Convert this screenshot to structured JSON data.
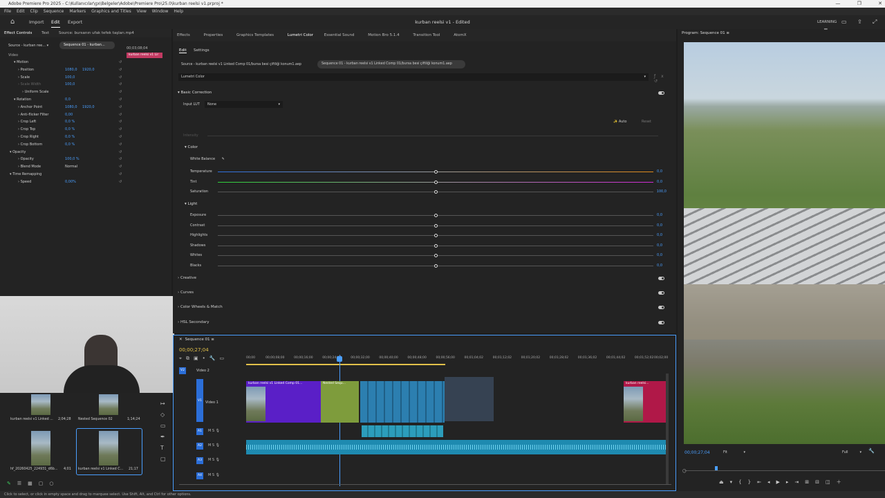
{
  "window": {
    "title": "Adobe Premiere Pro 2025 - C:\\Kullanıcılar\\gx\\Belgeler\\Adobe\\Premiere Pro\\25.0\\kurban reelsi v1.prproj *",
    "minimize": "—",
    "maximize": "❐",
    "close": "✕"
  },
  "menu": [
    "File",
    "Edit",
    "Clip",
    "Sequence",
    "Markers",
    "Graphics and Titles",
    "View",
    "Window",
    "Help"
  ],
  "header": {
    "home_icon": "home-icon",
    "tabs": [
      "Import",
      "Edit",
      "Export"
    ],
    "project_title": "kurban reelsi v1 - Edited",
    "learning": "LEARNING"
  },
  "effect_controls": {
    "tabs": [
      "Effect Controls",
      "Text",
      "Source: bursanın ufak tefek taşları.mp4"
    ],
    "source_clip": "Source - kurban ree...",
    "sequence_clip": "Sequence 01 - kurban...",
    "timecode": "00;03;08;04",
    "clip_name": "kurban reelsi v1 Lir",
    "video_label": "Video",
    "rows": [
      {
        "name": "Motion",
        "v1": "",
        "v2": ""
      },
      {
        "name": "Position",
        "v1": "1080,0",
        "v2": "1920,0"
      },
      {
        "name": "Scale",
        "v1": "100,0",
        "v2": ""
      },
      {
        "name": "Scale Width",
        "v1": "100,0",
        "v2": ""
      },
      {
        "name": "Uniform Scale",
        "v1": "",
        "v2": ""
      },
      {
        "name": "Rotation",
        "v1": "0,0",
        "v2": ""
      },
      {
        "name": "Anchor Point",
        "v1": "1080,0",
        "v2": "1920,0"
      },
      {
        "name": "Anti-flicker Filter",
        "v1": "0,00",
        "v2": ""
      },
      {
        "name": "Crop Left",
        "v1": "0,0 %",
        "v2": ""
      },
      {
        "name": "Crop Top",
        "v1": "0,0 %",
        "v2": ""
      },
      {
        "name": "Crop Right",
        "v1": "0,0 %",
        "v2": ""
      },
      {
        "name": "Crop Bottom",
        "v1": "0,0 %",
        "v2": ""
      },
      {
        "name": "Opacity",
        "v1": "",
        "v2": ""
      },
      {
        "name": "Opacity",
        "v1": "100,0 %",
        "v2": ""
      },
      {
        "name": "Blend Mode",
        "v1": "Normal",
        "v2": ""
      },
      {
        "name": "Time Remapping",
        "v1": "",
        "v2": ""
      },
      {
        "name": "Speed",
        "v1": "0,00%",
        "v2": ""
      }
    ]
  },
  "lumetri": {
    "tabs": [
      "Effects",
      "Properties",
      "Graphics Templates",
      "Lumetri Color",
      "Essential Sound",
      "Motion Bro 5.1.4",
      "Transition Tool",
      "AtomX"
    ],
    "subtabs": [
      "Edit",
      "Settings"
    ],
    "source_crumb": "Source - kurban reelsi v1 Linked Comp 01/bursa besi çiftliği konum1.aep",
    "seq_crumb": "Sequence 01 - kurban reelsi v1 Linked Comp 01/bursa besi çiftliği konum1.aep",
    "effect_name": "Lumetri Color",
    "basic_correction": "Basic Correction",
    "input_lut_label": "Input LUT",
    "input_lut_value": "None",
    "auto": "Auto",
    "reset": "Reset",
    "intensity": "Intensity",
    "color_section": "Color",
    "white_balance": "White Balance",
    "color_rows": [
      {
        "label": "Temperature",
        "value": "0,0"
      },
      {
        "label": "Tint",
        "value": "0,0"
      },
      {
        "label": "Saturation",
        "value": "100,0"
      }
    ],
    "light_section": "Light",
    "light_rows": [
      {
        "label": "Exposure",
        "value": "0,0"
      },
      {
        "label": "Contrast",
        "value": "0,0"
      },
      {
        "label": "Highlights",
        "value": "0,0"
      },
      {
        "label": "Shadows",
        "value": "0,0"
      },
      {
        "label": "Whites",
        "value": "0,0"
      },
      {
        "label": "Blacks",
        "value": "0,0"
      }
    ],
    "sections": [
      "Creative",
      "Curves",
      "Color Wheels & Match",
      "HSL Secondary"
    ]
  },
  "program": {
    "title": "Program: Sequence 01",
    "timecode": "00;00;27;04",
    "fit": "Fit",
    "full": "Full"
  },
  "project": {
    "items": [
      {
        "name": "kurban reelsi v1 Linked ...",
        "dur": "2;04;28"
      },
      {
        "name": "Nested Sequence 02",
        "dur": "1;14;24"
      },
      {
        "name": "hf_20260425_224931_d6b...",
        "dur": "4;01"
      },
      {
        "name": "kurban reelsi v1 Linked C...",
        "dur": "21;17"
      }
    ]
  },
  "timeline": {
    "title": "Sequence 01",
    "timecode": "00;00;27;04",
    "ruler": [
      "00;00",
      "00;00;08;00",
      "00;00;16;00",
      "00;00;24;00",
      "00;00;32;00",
      "00;00;40;00",
      "00;00;48;00",
      "00;00;56;00",
      "00;01;04;02",
      "00;01;12;02",
      "00;01;20;02",
      "00;01;28;02",
      "00;01;36;02",
      "00;01;44;02",
      "00;01;52;02",
      "00;02;00"
    ],
    "video_tracks": [
      "V2",
      "V1"
    ],
    "video_names": [
      "Video 2",
      "Video 1"
    ],
    "audio_tracks": [
      "A1",
      "A2",
      "A3",
      "A4"
    ],
    "clip_labels": [
      "kurban reelsi v1 Linked Comp 01...",
      "Nested Sequ...",
      "kurban reelsi..."
    ]
  },
  "status": "Click to select, or click in empty space and drag to marquee select. Use Shift, Alt, and Ctrl for other options."
}
